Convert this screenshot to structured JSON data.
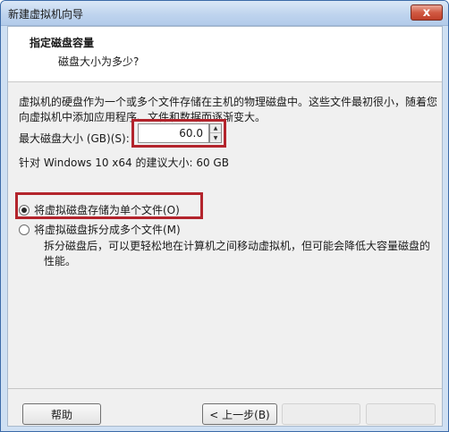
{
  "window": {
    "title": "新建虚拟机向导",
    "close_glyph": "x"
  },
  "header": {
    "title": "指定磁盘容量",
    "subtitle": "磁盘大小为多少?"
  },
  "description": "虚拟机的硬盘作为一个或多个文件存储在主机的物理磁盘中。这些文件最初很小，随着您向虚拟机中添加应用程序、文件和数据而逐渐变大。",
  "disk_size": {
    "label": "最大磁盘大小 (GB)(S):",
    "value": "60.0",
    "spin_up_glyph": "▲",
    "spin_down_glyph": "▼"
  },
  "recommendation": "针对 Windows 10 x64 的建议大小: 60 GB",
  "storage_options": {
    "selected": "single",
    "single_label": "将虚拟磁盘存储为单个文件(O)",
    "split_label": "将虚拟磁盘拆分成多个文件(M)",
    "split_description": "拆分磁盘后，可以更轻松地在计算机之间移动虚拟机，但可能会降低大容量磁盘的性能。"
  },
  "buttons": {
    "help": "帮助",
    "back": "< 上一步(B)",
    "next": "",
    "cancel": ""
  },
  "colors": {
    "highlight": "#b3242c",
    "title_gradient_top": "#dbe8f7",
    "close_button": "#c0402a"
  }
}
